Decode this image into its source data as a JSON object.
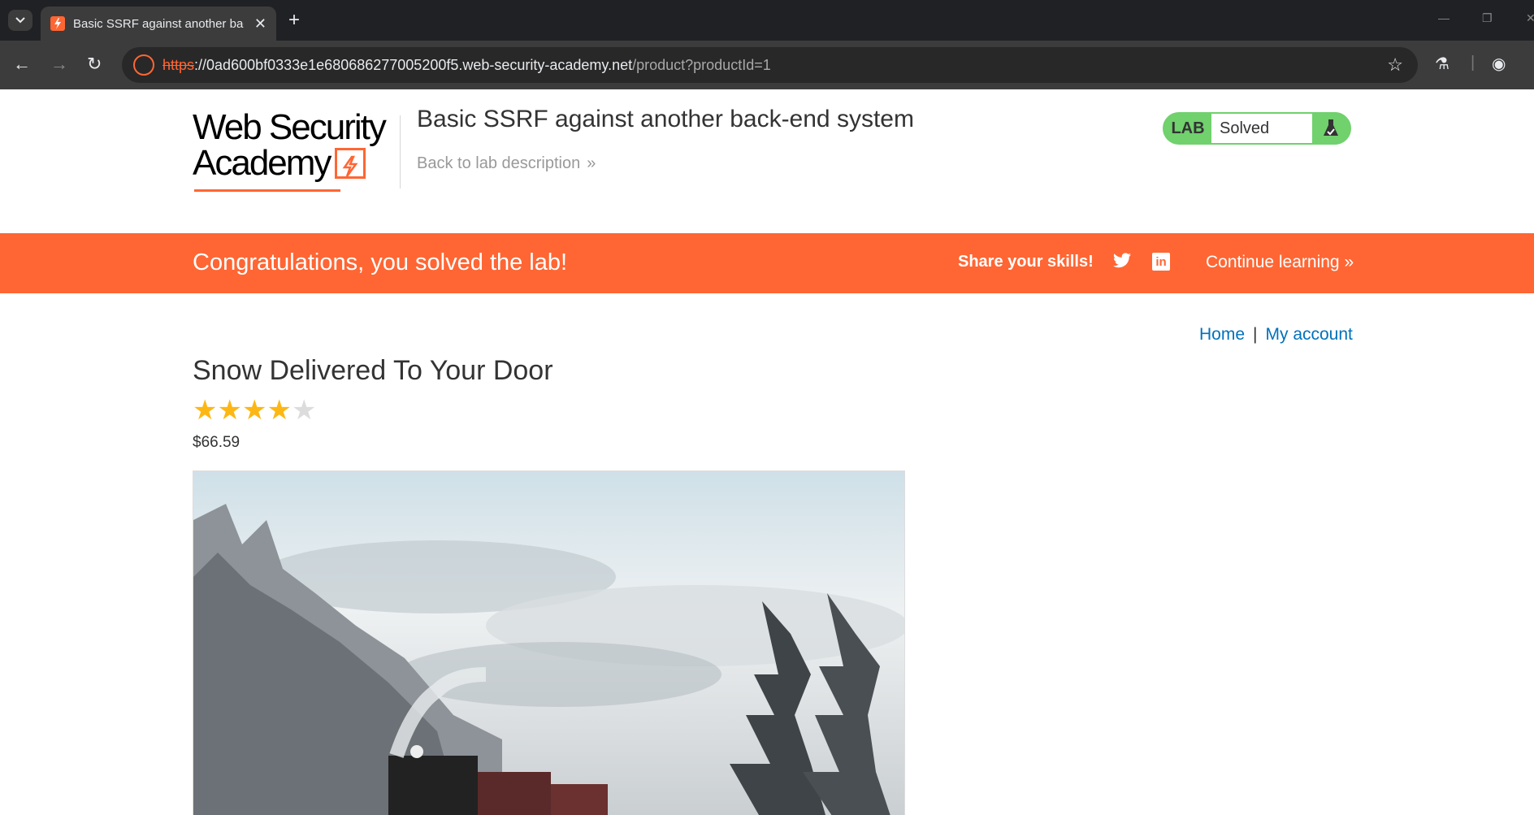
{
  "browser": {
    "tab_title": "Basic SSRF against another back-e",
    "url_scheme": "https",
    "url_host": "://0ad600bf0333e1e680686277005200f5.web-security-academy.net",
    "url_path": "/product?productId=1"
  },
  "header": {
    "logo_line1": "Web Security",
    "logo_line2": "Academy",
    "lab_title": "Basic SSRF against another back-end system",
    "back_link": "Back to lab description",
    "lab_tag": "LAB",
    "lab_status": "Solved"
  },
  "banner": {
    "congrats": "Congratulations, you solved the lab!",
    "share": "Share your skills!",
    "continue": "Continue learning"
  },
  "nav": {
    "home": "Home",
    "separator": "|",
    "account": "My account"
  },
  "product": {
    "title": "Snow Delivered To Your Door",
    "rating": 4,
    "max_rating": 5,
    "price": "$66.59"
  },
  "colors": {
    "accent": "#ff6633",
    "solved": "#70d16d",
    "link": "#0071bc",
    "star": "#fdb714",
    "star_empty": "#dcdcdc"
  }
}
